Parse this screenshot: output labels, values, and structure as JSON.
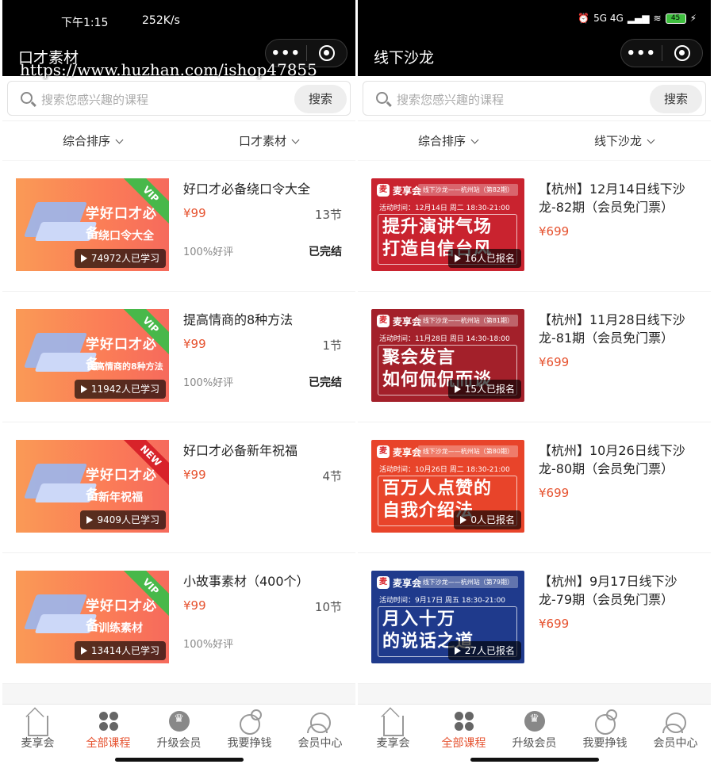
{
  "left": {
    "status": {
      "time": "下午1:15",
      "speed": "252K/s"
    },
    "title": "口才素材",
    "watermark": "https://www.huzhan.com/ishop47855",
    "search": {
      "placeholder": "搜索您感兴趣的课程",
      "button": "搜索"
    },
    "filters": [
      "综合排序",
      "口才素材"
    ],
    "items": [
      {
        "title": "好口才必备绕口令大全",
        "price": "¥99",
        "count": "13节",
        "rating": "100%好评",
        "status": "已完结",
        "tag": "VIP",
        "slogan": "学好口才必备",
        "subtitle": "绕口令大全",
        "learners": "74972人已学习"
      },
      {
        "title": "提高情商的8种方法",
        "price": "¥99",
        "count": "1节",
        "rating": "100%好评",
        "status": "已完结",
        "tag": "VIP",
        "slogan": "学好口才必备",
        "subtitle": "提高情商的8种方法",
        "learners": "11942人已学习"
      },
      {
        "title": "好口才必备新年祝福",
        "price": "¥99",
        "count": "4节",
        "rating": "",
        "status": "",
        "tag": "NEW",
        "slogan": "学好口才必备",
        "subtitle": "新年祝福",
        "learners": "9409人已学习"
      },
      {
        "title": "小故事素材（400个）",
        "price": "¥99",
        "count": "10节",
        "rating": "100%好评",
        "status": "",
        "tag": "VIP",
        "slogan": "学好口才必备",
        "subtitle": "训练素材",
        "learners": "13414人已学习"
      }
    ]
  },
  "right": {
    "status": {
      "badges": "5G 4G",
      "battery": "45"
    },
    "title": "线下沙龙",
    "search": {
      "placeholder": "搜索您感兴趣的课程",
      "button": "搜索"
    },
    "filters": [
      "综合排序",
      "线下沙龙"
    ],
    "items": [
      {
        "title": "【杭州】12月14日线下沙龙-82期（会员免门票）",
        "price": "¥699",
        "brand": "麦享会",
        "station": "线下沙龙——杭州站（第82期）",
        "time": "活动时间：12月14日 周二 18:30-21:00",
        "line1": "提升演讲气场",
        "line2": "打造自信台风",
        "signups": "16人已报名",
        "color": "#c9232f"
      },
      {
        "title": "【杭州】11月28日线下沙龙-81期（会员免门票）",
        "price": "¥699",
        "brand": "麦享会",
        "station": "线下沙龙——杭州站（第81期）",
        "time": "活动时间：11月28日 周日 14:30-18:00",
        "line1": "聚会发言",
        "line2": "如何侃侃而谈",
        "signups": "15人已报名",
        "color": "#a3202a"
      },
      {
        "title": "【杭州】10月26日线下沙龙-80期（会员免门票）",
        "price": "¥699",
        "brand": "麦享会",
        "station": "线下沙龙——杭州站（第80期）",
        "time": "活动时间：10月26日 周二 18:30-21:00",
        "line1": "百万人点赞的",
        "line2": "自我介绍法",
        "signups": "0人已报名",
        "color": "#e8442a"
      },
      {
        "title": "【杭州】9月17日线下沙龙-79期（会员免门票）",
        "price": "¥699",
        "brand": "麦享会",
        "station": "线下沙龙——杭州站（第79期）",
        "time": "活动时间：9月17日 周五 18:30-21:00",
        "line1": "月入十万",
        "line2": "的说话之道",
        "signups": "27人已报名",
        "color": "#1f3a8c"
      }
    ]
  },
  "nav": {
    "items": [
      {
        "label": "麦享会",
        "icon": "home-icon"
      },
      {
        "label": "全部课程",
        "icon": "clover-icon"
      },
      {
        "label": "升级会员",
        "icon": "crown-icon"
      },
      {
        "label": "我要挣钱",
        "icon": "money-icon"
      },
      {
        "label": "会员中心",
        "icon": "user-icon"
      }
    ],
    "active_index": 1
  },
  "colors": {
    "accent": "#e6522f",
    "vip": "#48b84a",
    "new": "#d8232a"
  }
}
